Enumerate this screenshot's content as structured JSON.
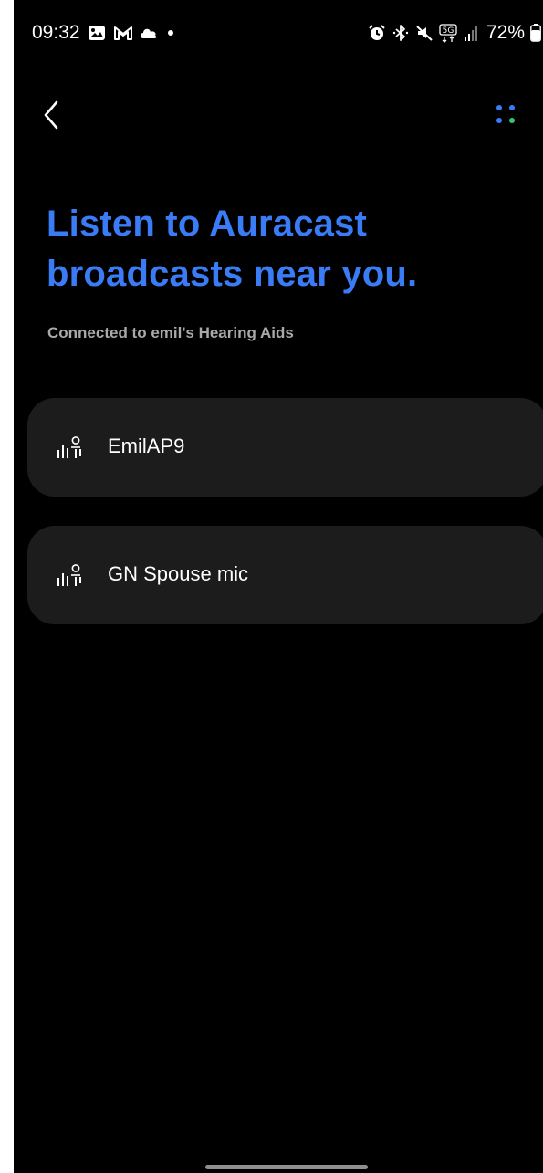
{
  "status_bar": {
    "time": "09:32",
    "left_icons": [
      "gallery-icon",
      "gmail-icon",
      "cloud-icon"
    ],
    "right_icons": [
      "alarm-icon",
      "bluetooth-icon",
      "mute-icon",
      "5g-icon",
      "signal-icon"
    ],
    "network": "5G",
    "battery_percent": "72%",
    "battery_icon": "battery-icon"
  },
  "nav": {
    "back_icon": "chevron-left-icon",
    "menu_icon": "more-options-icon",
    "menu_dot_colors": [
      "#3a7cf6",
      "#3a7cf6",
      "#3a7cf6",
      "#37c27a"
    ]
  },
  "header": {
    "title_line1": "Listen to Auracast",
    "title_line2": "broadcasts near you.",
    "subtitle": "Connected to emil's Hearing Aids"
  },
  "broadcasts": [
    {
      "icon": "auracast-broadcast-icon",
      "name": "EmilAP9"
    },
    {
      "icon": "auracast-broadcast-icon",
      "name": "GN Spouse mic"
    }
  ],
  "colors": {
    "accent": "#3a7cf6",
    "background": "#000000",
    "card": "#1c1c1c",
    "subtitle": "#a9a9a9",
    "text": "#ffffff"
  }
}
